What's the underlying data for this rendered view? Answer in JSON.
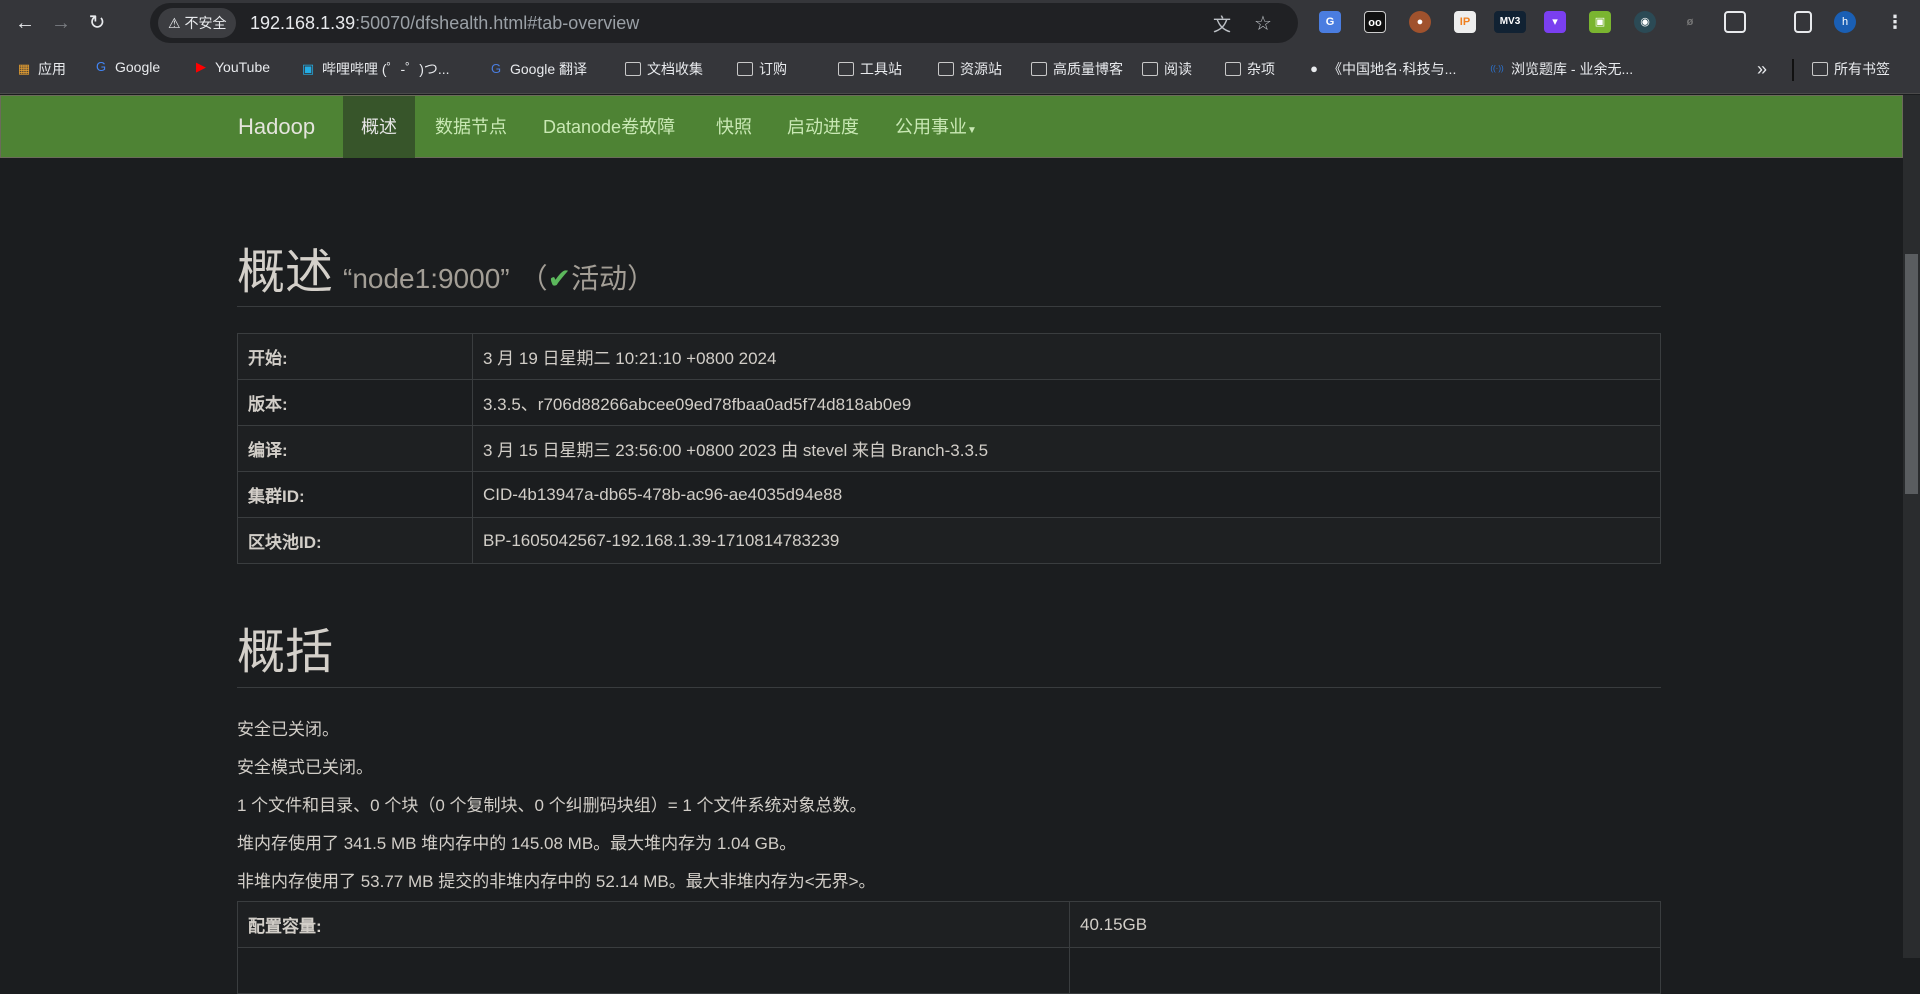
{
  "browser": {
    "security_label": "不安全",
    "url_host": "192.168.1.39",
    "url_rest": ":50070/dfshealth.html#tab-overview",
    "extensions": [
      "google-translate",
      "privacy",
      "cookie",
      "ip",
      "mv3",
      "purple-ext",
      "green-ext",
      "spy-ext",
      "hidden-ext",
      "extensions-puzzle"
    ],
    "mv3_label": "MV3",
    "ip_label": "IP",
    "profile_initial": "h",
    "bookmarks": [
      {
        "label": "应用",
        "icon": "apps-grid-icon"
      },
      {
        "label": "Google",
        "icon": "google-icon"
      },
      {
        "label": "YouTube",
        "icon": "youtube-icon"
      },
      {
        "label": "哔哩哔哩 (゜-゜)つ...",
        "icon": "bilibili-icon"
      },
      {
        "label": "Google 翻译",
        "icon": "translate-icon"
      },
      {
        "label": "文档收集",
        "icon": "folder-icon"
      },
      {
        "label": "订购",
        "icon": "folder-icon"
      },
      {
        "label": "工具站",
        "icon": "folder-icon"
      },
      {
        "label": "资源站",
        "icon": "folder-icon"
      },
      {
        "label": "高质量博客",
        "icon": "folder-icon"
      },
      {
        "label": "阅读",
        "icon": "folder-icon"
      },
      {
        "label": "杂项",
        "icon": "folder-icon"
      },
      {
        "label": "《中国地名·科技与...",
        "icon": "globe-icon"
      },
      {
        "label": "浏览题库 - 业余无...",
        "icon": "radio-icon"
      }
    ],
    "more_label": "»",
    "all_bookmarks": "所有书签"
  },
  "navbar": {
    "brand": "Hadoop",
    "items": [
      "概述",
      "数据节点",
      "Datanode卷故障",
      "快照",
      "启动进度",
      "公用事业"
    ],
    "active": 0
  },
  "overview": {
    "title": "概述",
    "node": "“node1:9000”",
    "status_open": "（",
    "status": "活动",
    "status_close": "）",
    "rows": [
      {
        "label": "开始:",
        "value": "3 月 19 日星期二 10:21:10 +0800 2024"
      },
      {
        "label": "版本:",
        "value": "3.3.5、r706d88266abcee09ed78fbaa0ad5f74d818ab0e9"
      },
      {
        "label": "编译:",
        "value": "3 月 15 日星期三 23:56:00 +0800 2023 由 stevel 来自 Branch-3.3.5"
      },
      {
        "label": "集群ID:",
        "value": "CID-4b13947a-db65-478b-ac96-ae4035d94e88"
      },
      {
        "label": "区块池ID:",
        "value": "BP-1605042567-192.168.1.39-1710814783239"
      }
    ]
  },
  "summary": {
    "title": "概括",
    "lines": [
      "安全已关闭。",
      "安全模式已关闭。",
      "1 个文件和目录、0 个块（0 个复制块、0 个纠删码块组）= 1 个文件系统对象总数。",
      "堆内存使用了 341.5 MB 堆内存中的 145.08 MB。最大堆内存为 1.04 GB。",
      "非堆内存使用了 53.77 MB 提交的非堆内存中的 52.14 MB。最大非堆内存为<无界>。"
    ],
    "rows": [
      {
        "label": "配置容量:",
        "value": "40.15GB"
      },
      {
        "label": "",
        "value": ""
      }
    ]
  }
}
